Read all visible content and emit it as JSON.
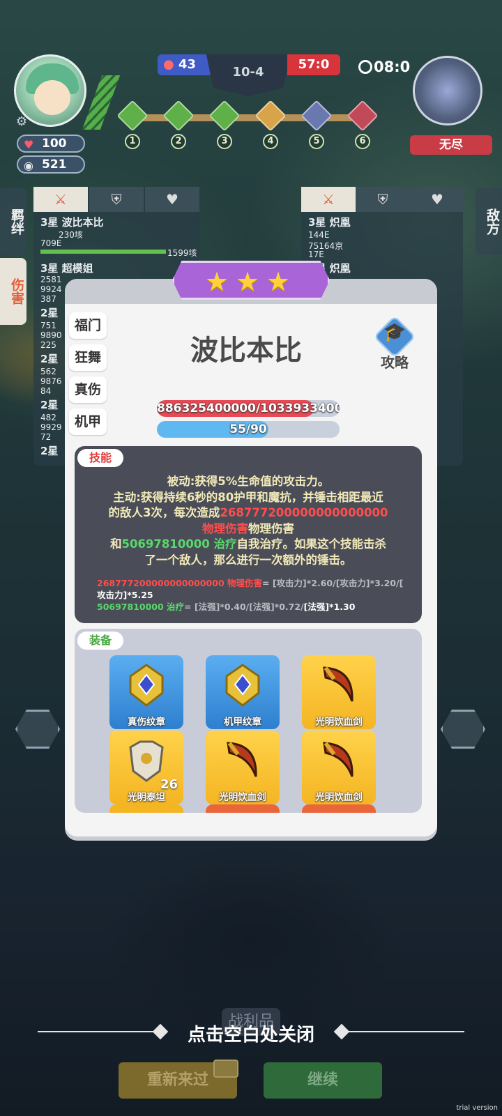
{
  "hud": {
    "player_hp": "100",
    "player_coins": "521",
    "blue_score": "43",
    "stage_label": "10-4",
    "red_score": "57:0",
    "timer": "08:0",
    "enemy_tag": "无尽",
    "stages": [
      {
        "num": "1",
        "color": "#5fb048"
      },
      {
        "num": "2",
        "color": "#5fb048"
      },
      {
        "num": "3",
        "color": "#5fb048"
      },
      {
        "num": "4",
        "color": "#d7a44a"
      },
      {
        "num": "5",
        "color": "#6a78b0"
      },
      {
        "num": "6",
        "color": "#c04a5a"
      }
    ]
  },
  "side_tabs": {
    "bonds": "羁绊",
    "damage": "伤害",
    "enemy": "敌方"
  },
  "team_left": {
    "rows": [
      {
        "name": "3星 波比本比",
        "sub1": "230垓",
        "sub2": "709E",
        "sub3": "1599垓"
      },
      {
        "name": "3星 超模姐",
        "sub1": "2581",
        "sub2": "9924",
        "sub3": "387"
      },
      {
        "name": "2星",
        "sub1": "751",
        "sub2": "9890",
        "sub3": "225"
      },
      {
        "name": "2星",
        "sub1": "562",
        "sub2": "9876",
        "sub3": "84"
      },
      {
        "name": "2星",
        "sub1": "482",
        "sub2": "9929",
        "sub3": "72"
      },
      {
        "name": "2星"
      }
    ]
  },
  "team_right": {
    "rows": [
      {
        "name": "3星 炽凰",
        "sub1": "144E",
        "sub2": "75164京",
        "sub3": "17E"
      },
      {
        "name": "3星 炽凰"
      }
    ]
  },
  "modal": {
    "hero_name": "波比本比",
    "guide_label": "攻略",
    "left_tabs": [
      "福门",
      "狂舞",
      "真伤",
      "机甲"
    ],
    "hp_text": "886325400000/1033933400",
    "hp_ratio": 0.86,
    "mp_text": "55/90",
    "mp_ratio": 0.61,
    "skill_tag": "技能",
    "skill": {
      "line1": "被动:获得5%生命值的攻击力。",
      "line2": "主动:获得持续6秒的80护甲和魔抗，并锤击相距最近",
      "line3a": "的敌人3次，每次造成",
      "line3b": "268777200000000000000",
      "line4a": "物理伤害",
      "line4b": "物理伤害",
      "line5a": "和",
      "line5b": "50697810000 治疗",
      "line5c": "自我治疗。如果这个技能击杀",
      "line6": "了一个敌人，那么进行一次额外的锤击。",
      "f1a": "268777200000000000000 物理伤害",
      "f1b": "= [攻击力]*2.60/[攻击力]*3.20/[",
      "f2": "攻击力]*5.25",
      "f3a": "50697810000 治疗",
      "f3b": "= [法强]*0.40/[法强]*0.72/",
      "f3c": "[法强]*1.30"
    },
    "equip_tag": "装备",
    "equipment": [
      {
        "name": "真伤纹章",
        "kind": "blue",
        "icon": "emblem-icon"
      },
      {
        "name": "机甲纹章",
        "kind": "blue",
        "icon": "emblem-icon"
      },
      {
        "name": "光明饮血剑",
        "kind": "gold",
        "icon": "scythe-icon"
      },
      {
        "name": "光明泰坦",
        "kind": "gold",
        "icon": "armor-icon",
        "count": "26"
      },
      {
        "name": "光明饮血剑",
        "kind": "gold",
        "icon": "scythe-icon"
      },
      {
        "name": "光明饮血剑",
        "kind": "gold",
        "icon": "scythe-icon"
      }
    ]
  },
  "bottom": {
    "close_hint": "点击空白处关闭",
    "loot_label": "战利品",
    "retry": "重新来过",
    "continue": "继续",
    "trial": "trial version"
  }
}
